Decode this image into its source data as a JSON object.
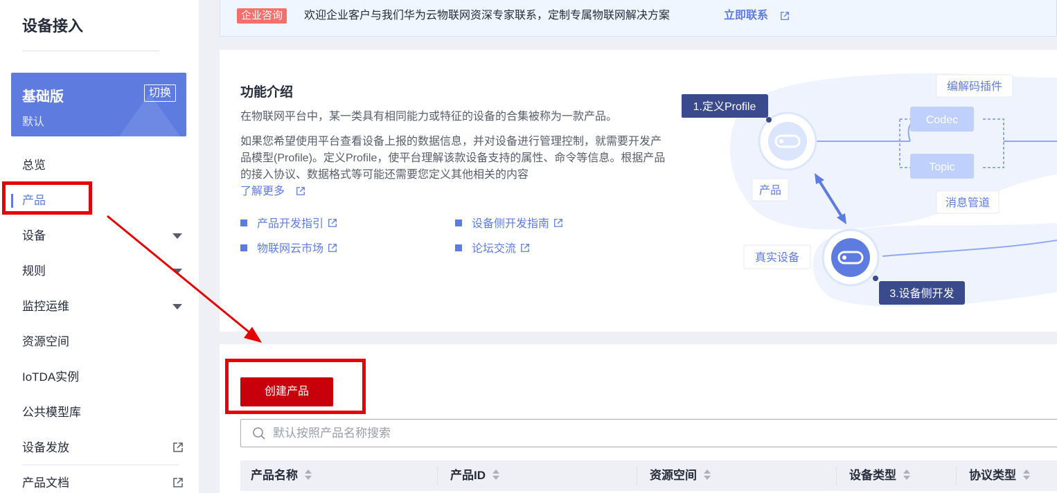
{
  "sidebar": {
    "title": "设备接入",
    "edition": {
      "name": "基础版",
      "subtitle": "默认",
      "switch_label": "切换"
    },
    "items": [
      {
        "label": "总览"
      },
      {
        "label": "产品",
        "active": true
      },
      {
        "label": "设备"
      },
      {
        "label": "规则"
      },
      {
        "label": "监控运维"
      },
      {
        "label": "资源空间"
      },
      {
        "label": "IoTDA实例"
      },
      {
        "label": "公共模型库"
      },
      {
        "label": "设备发放"
      },
      {
        "label": "产品文档"
      }
    ]
  },
  "banner": {
    "tag": "企业咨询",
    "text": "欢迎企业客户与我们华为云物联网资深专家联系，定制专属物联网解决方案",
    "link": "立即联系"
  },
  "intro": {
    "title": "功能介绍",
    "p1": "在物联网平台中，某一类具有相同能力或特征的设备的合集被称为一款产品。",
    "p2": "如果您希望使用平台查看设备上报的数据信息，并对设备进行管理控制，就需要开发产品模型(Profile)。定义Profile，使平台理解该款设备支持的属性、命令等信息。根据产品的接入协议、数据格式等可能还需要您定义其他相关的内容",
    "learn_more": "了解更多",
    "links": [
      "产品开发指引",
      "设备侧开发指南",
      "物联网云市场",
      "论坛交流"
    ],
    "diagram": {
      "step1": "1.定义Profile",
      "codec_plugin": "编解码插件",
      "codec": "Codec",
      "topic": "Topic",
      "product": "产品",
      "message_pipe": "消息管道",
      "real_device": "真实设备",
      "step3": "3.设备侧开发"
    }
  },
  "list": {
    "create_label": "创建产品",
    "search_placeholder": "默认按照产品名称搜索",
    "columns": [
      "产品名称",
      "产品ID",
      "资源空间",
      "设备类型",
      "协议类型"
    ]
  },
  "colors": {
    "accent": "#5e7ce0",
    "create_button": "#c7000b",
    "annotation": "#e60000"
  }
}
